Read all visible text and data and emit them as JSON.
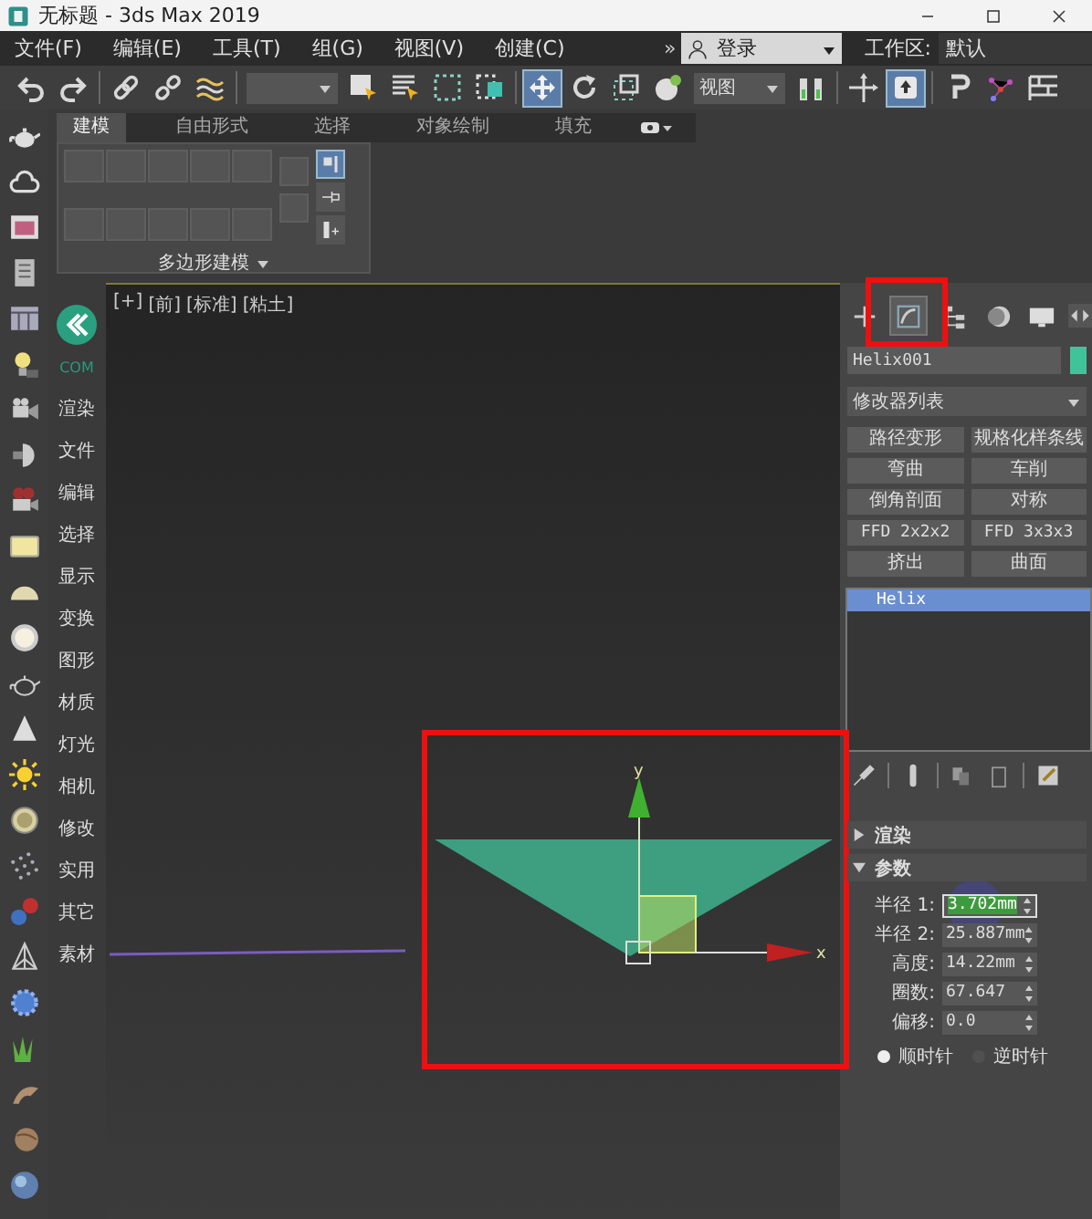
{
  "window": {
    "title": "无标题 - 3ds Max 2019"
  },
  "menu_bar": {
    "items": [
      "文件(F)",
      "编辑(E)",
      "工具(T)",
      "组(G)",
      "视图(V)",
      "创建(C)"
    ],
    "overflow": "»",
    "sign_in": "登录",
    "workspace_label": "工作区:",
    "workspace": "默认"
  },
  "toolbar": {
    "tools": [
      {
        "kind": "undo",
        "selected": false
      },
      {
        "kind": "redo",
        "selected": false
      },
      {
        "kind": "link",
        "selected": false
      },
      {
        "kind": "unlink",
        "selected": false
      },
      {
        "kind": "wave",
        "selected": false
      },
      {
        "kind": "dropdown",
        "selected": false
      },
      {
        "kind": "select",
        "selected": false
      },
      {
        "kind": "select_by_name",
        "selected": false
      },
      {
        "kind": "rect_select",
        "selected": false
      },
      {
        "kind": "crossing",
        "selected": false
      },
      {
        "kind": "move",
        "selected": true
      },
      {
        "kind": "rotate",
        "selected": false
      },
      {
        "kind": "scale",
        "selected": false
      },
      {
        "kind": "placement",
        "selected": false
      },
      {
        "kind": "dropdown",
        "label": "视图",
        "selected": false
      },
      {
        "kind": "pivot",
        "selected": false
      },
      {
        "kind": "axis_cross",
        "selected": false
      },
      {
        "kind": "manipulate",
        "selected": true
      },
      {
        "kind": "snap",
        "selected": false
      },
      {
        "kind": "points",
        "selected": false
      },
      {
        "kind": "grid",
        "selected": false
      }
    ]
  },
  "ribbon": {
    "tabs": [
      {
        "label": "建模",
        "selected": true
      },
      {
        "label": "自由形式",
        "selected": false
      },
      {
        "label": "选择",
        "selected": false
      },
      {
        "label": "对象绘制",
        "selected": false
      },
      {
        "label": "填充",
        "selected": false
      }
    ],
    "toggles": [
      {
        "selected": true
      },
      {
        "selected": false
      },
      {
        "selected": false
      }
    ],
    "panel_title": "多边形建模"
  },
  "plugin_bar": {
    "badge": "COM",
    "items": [
      "渲染",
      "文件",
      "编辑",
      "选择",
      "显示",
      "变换",
      "图形",
      "材质",
      "灯光",
      "相机",
      "修改",
      "实用",
      "其它",
      "素材"
    ]
  },
  "viewport": {
    "labels": [
      "[+]",
      "[前]",
      "[标准]",
      "[粘土]"
    ],
    "axes": {
      "y": "y",
      "x": "x"
    }
  },
  "command_panel": {
    "tabs": [
      {
        "kind": "create",
        "selected": false
      },
      {
        "kind": "modify",
        "selected": true
      },
      {
        "kind": "hierarchy",
        "selected": false
      },
      {
        "kind": "motion",
        "selected": false
      },
      {
        "kind": "display",
        "selected": false
      }
    ],
    "object_name": "Helix001",
    "modifier_list": "修改器列表",
    "modifier_buttons": [
      "路径变形",
      "规格化样条线",
      "弯曲",
      "车削",
      "倒角剖面",
      "对称",
      "FFD 2x2x2",
      "FFD 3x3x3",
      "挤出",
      "曲面"
    ],
    "stack": [
      {
        "label": "Helix",
        "selected": true
      }
    ],
    "rollouts": [
      {
        "title": "渲染",
        "expanded": false
      },
      {
        "title": "参数",
        "expanded": true,
        "fields": [
          {
            "label": "半径 1:",
            "value": "3.702mm",
            "focused": true
          },
          {
            "label": "半径 2:",
            "value": "25.887mm",
            "focused": false
          },
          {
            "label": "高度:",
            "value": "14.22mm",
            "focused": false
          },
          {
            "label": "圈数:",
            "value": "67.647",
            "focused": false
          },
          {
            "label": "偏移:",
            "value": "0.0",
            "focused": false
          }
        ],
        "radios": [
          {
            "label": "顺时针",
            "selected": true
          },
          {
            "label": "逆时针",
            "selected": false
          }
        ]
      }
    ]
  }
}
